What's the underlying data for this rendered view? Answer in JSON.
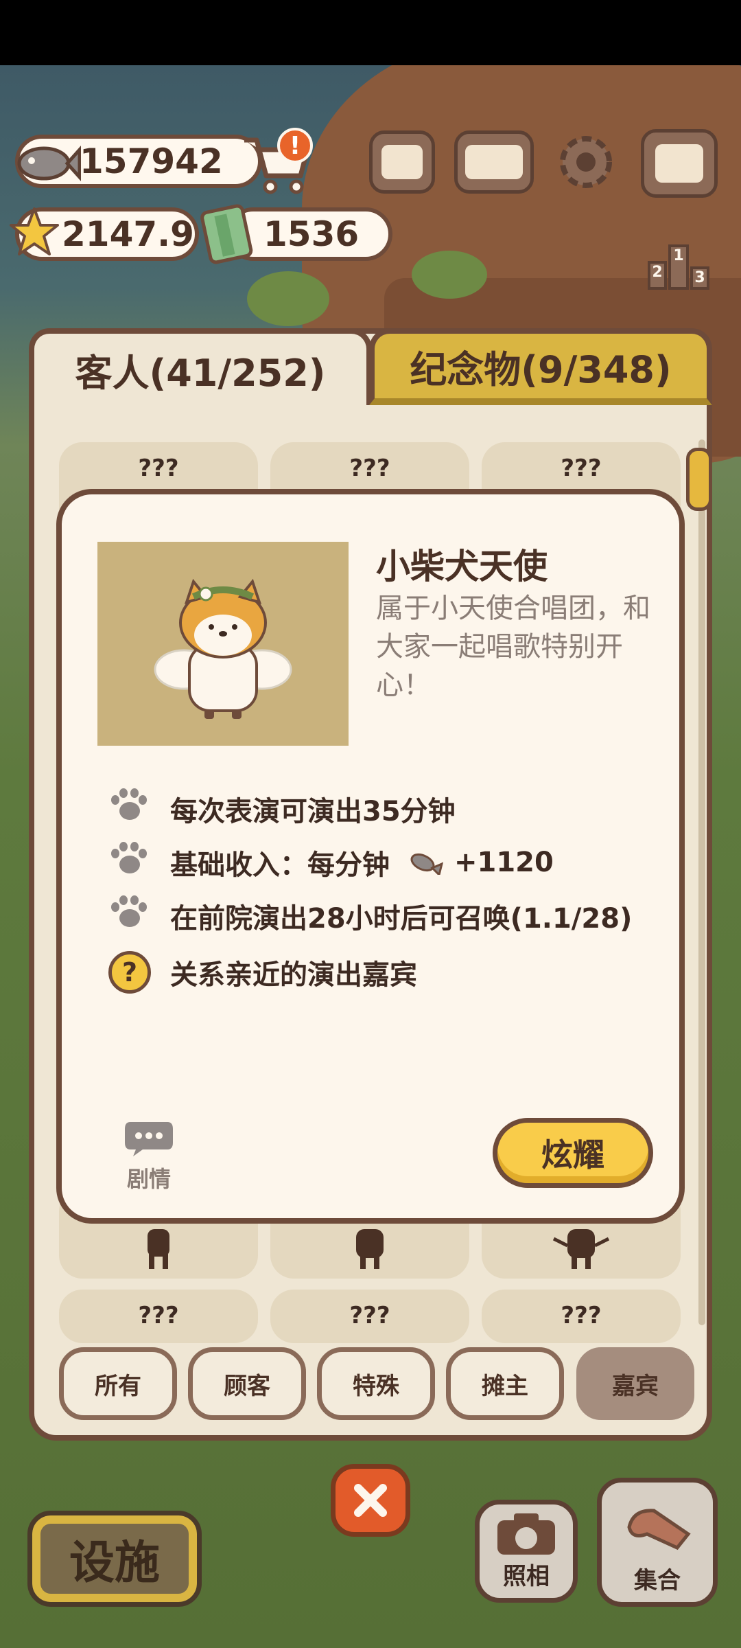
{
  "hud": {
    "fish_amount": "157942",
    "star_amount": "2147.9",
    "cash_amount": "1536",
    "cart_alert": "!",
    "icons": [
      "fish-icon",
      "shopping-cart-icon",
      "star-icon",
      "cash-icon",
      "newspaper-icon",
      "paw-book-icon",
      "gear-icon",
      "shop-icon",
      "leaderboard-icon"
    ],
    "leaderboard_digits": [
      "2",
      "1",
      "3"
    ]
  },
  "tabs": {
    "guests": "客人(41/252)",
    "souvenirs": "纪念物(9/348)"
  },
  "grid": {
    "unknown_label": "???"
  },
  "filters": [
    "所有",
    "顾客",
    "特殊",
    "摊主",
    "嘉宾"
  ],
  "filters_active": "嘉宾",
  "dialog": {
    "name": "小柴犬天使",
    "description": "属于小天使合唱团，和大家一起唱歌特别开心！",
    "rows": [
      "每次表演可演出35分钟",
      "基础收入：每分钟",
      "在前院演出28小时后可召唤(1.1/28)",
      "关系亲近的演出嘉宾"
    ],
    "income_value": "+1120",
    "help_symbol": "?",
    "story_label": "剧情",
    "show_off_label": "炫耀"
  },
  "bottom": {
    "facilities_label": "设施",
    "camera_label": "照相",
    "gather_label": "集合"
  },
  "colors": {
    "border_brown": "#6e4b3a",
    "accent_yellow": "#f9cc4a",
    "close_red": "#e25b2a",
    "panel_beige": "#efe6d4"
  }
}
